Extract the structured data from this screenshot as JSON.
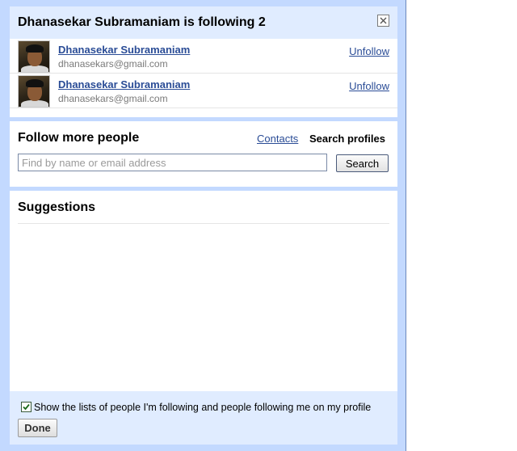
{
  "dialog": {
    "title": "Dhanasekar Subramaniam is following 2"
  },
  "following": [
    {
      "name": "Dhanasekar Subramaniam",
      "email": "dhanasekars@gmail.com",
      "action": "Unfollow"
    },
    {
      "name": "Dhanasekar Subramaniam",
      "email": "dhanasekars@gmail.com",
      "action": "Unfollow"
    }
  ],
  "follow_more": {
    "title": "Follow more people",
    "contacts_link": "Contacts",
    "search_profiles_tab": "Search profiles",
    "search_placeholder": "Find by name or email address",
    "search_button": "Search"
  },
  "suggestions": {
    "title": "Suggestions"
  },
  "footer": {
    "checkbox_label": "Show the lists of people I'm following and people following me on my profile",
    "checkbox_checked": true,
    "done_button": "Done"
  },
  "colors": {
    "dialog_frame": "#c3d9ff",
    "header_band": "#e0ecff",
    "link": "#2a4c96"
  }
}
